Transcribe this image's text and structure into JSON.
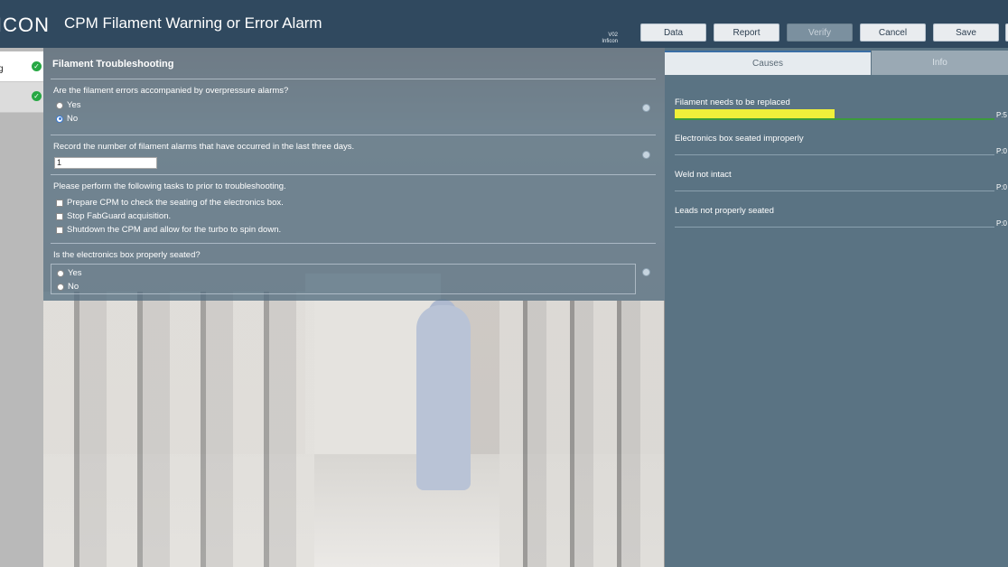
{
  "header": {
    "logo": "ICON",
    "title": "CPM Filament Warning or Error Alarm",
    "version": "V02",
    "vendor": "Inficon",
    "buttons": {
      "data": "Data",
      "report": "Report",
      "verify": "Verify",
      "cancel": "Cancel",
      "save": "Save"
    }
  },
  "nav": {
    "items": [
      {
        "label": "g",
        "status": "complete"
      },
      {
        "label": "",
        "status": "complete"
      }
    ]
  },
  "form": {
    "title": "Filament Troubleshooting",
    "q1": {
      "text": "Are the filament errors accompanied by overpressure alarms?",
      "options": [
        "Yes",
        "No"
      ],
      "selected": "No"
    },
    "q2": {
      "text": "Record the number of filament alarms that have occurred in the last three days.",
      "value": "1"
    },
    "q3": {
      "text": "Please perform the following tasks to prior to troubleshooting.",
      "tasks": [
        "Prepare CPM to check the seating of the electronics box.",
        "Stop FabGuard acquisition.",
        "Shutdown the CPM and allow for the turbo to spin down."
      ]
    },
    "q4": {
      "text": "Is the electronics box properly seated?",
      "options": [
        "Yes",
        "No"
      ],
      "selected": ""
    }
  },
  "right_panel": {
    "tabs": {
      "causes": "Causes",
      "info": "Info"
    },
    "causes": [
      {
        "label": "Filament needs to be replaced",
        "score": "P:5",
        "fill": 0.5
      },
      {
        "label": "Electronics box seated improperly",
        "score": "P:0",
        "fill": 0
      },
      {
        "label": "Weld not intact",
        "score": "P:0",
        "fill": 0
      },
      {
        "label": "Leads not properly seated",
        "score": "P:0",
        "fill": 0
      }
    ]
  },
  "colors": {
    "header_bg": "#30495f",
    "accent_check": "#27a844",
    "cause_fill": "#f0f03a",
    "cause_line": "#3b9b3b"
  }
}
